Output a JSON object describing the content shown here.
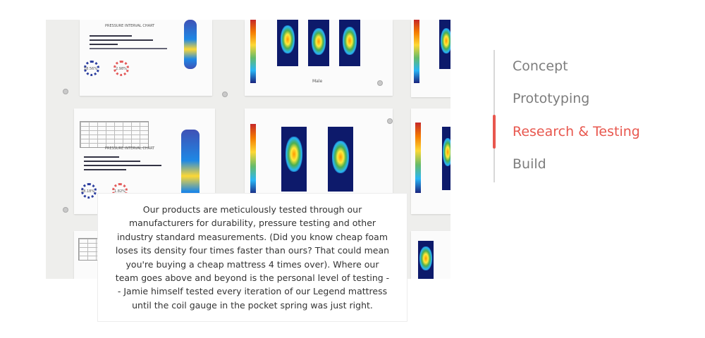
{
  "photo": {
    "description_label": "testing-wall-photo",
    "chart_titles": [
      "PRESSURE INTERVAL CHART",
      "PRESSURE INTERVAL CHART"
    ],
    "badge_values": [
      "18.56%",
      "2.98%",
      "18.18%",
      "1.82%"
    ],
    "scan_label": "Male"
  },
  "caption": {
    "text": "Our products are meticulously tested through our manufacturers for durability, pressure testing and other industry standard measurements. (Did you know cheap foam loses its density four times faster than ours? That could mean you're buying a cheap mattress 4 times over). Where our team goes above and beyond is the personal level of testing -- Jamie himself tested every iteration of our Legend mattress until the coil gauge in the pocket spring was just right."
  },
  "nav": {
    "items": [
      {
        "label": "Concept",
        "active": false
      },
      {
        "label": "Prototyping",
        "active": false
      },
      {
        "label": "Research & Testing",
        "active": true
      },
      {
        "label": "Build",
        "active": false
      }
    ],
    "accent_color": "#e8574e",
    "inactive_color": "#7d7d7d"
  }
}
